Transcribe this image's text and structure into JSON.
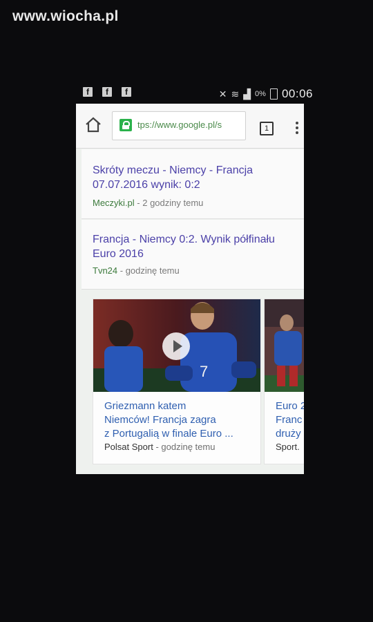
{
  "watermark": "www.wiocha.pl",
  "status_bar": {
    "notification_icons": [
      "facebook-icon",
      "facebook-icon",
      "facebook-icon"
    ],
    "battery_percent": "0%",
    "time": "00:06"
  },
  "browser": {
    "url": "tps://www.google.pl/s",
    "tab_count": "1"
  },
  "results": [
    {
      "title": "Skróty meczu - Niemcy - Francja 07.07.2016 wynik: 0:2",
      "source": "Meczyki.pl",
      "time": " - 2 godziny temu"
    },
    {
      "title": "Francja - Niemcy 0:2. Wynik półfinału Euro 2016",
      "source": "Tvn24",
      "time": " - godzinę temu"
    }
  ],
  "news_cards": [
    {
      "title_lines": [
        "Griezmann katem",
        "Niemców! Francja zagra",
        "z Portugalią w finale Euro ..."
      ],
      "source": "Polsat Sport",
      "time": " - godzinę temu",
      "jersey_number": "7"
    },
    {
      "title_lines": [
        "Euro 2",
        "Franc",
        "druży"
      ],
      "source": "Sport.",
      "time": ""
    }
  ],
  "colors": {
    "link_purple": "#4b40a8",
    "link_blue": "#2f5fb0",
    "source_green": "#3c7a3c",
    "lock_green": "#2bb24c"
  }
}
